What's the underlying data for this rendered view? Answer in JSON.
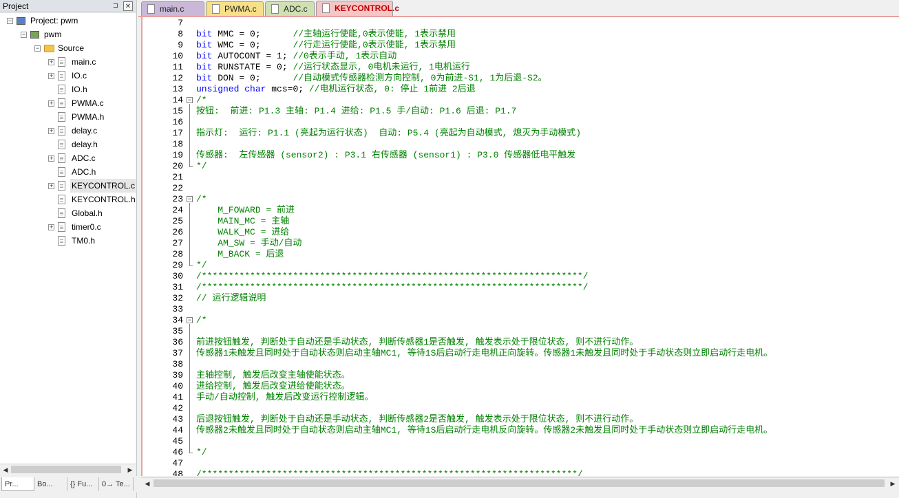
{
  "project_panel": {
    "title": "Project",
    "pin_glyph": "⊐",
    "close_glyph": "✕",
    "tree": [
      {
        "label": "Project: pwm",
        "type": "project",
        "expanded": true
      },
      {
        "label": "pwm",
        "type": "target",
        "expanded": true
      },
      {
        "label": "Source",
        "type": "folder",
        "expanded": true
      },
      {
        "label": "main.c",
        "type": "file",
        "expandable": true
      },
      {
        "label": "IO.c",
        "type": "file",
        "expandable": true
      },
      {
        "label": "IO.h",
        "type": "file",
        "expandable": false
      },
      {
        "label": "PWMA.c",
        "type": "file",
        "expandable": true
      },
      {
        "label": "PWMA.h",
        "type": "file",
        "expandable": false
      },
      {
        "label": "delay.c",
        "type": "file",
        "expandable": true
      },
      {
        "label": "delay.h",
        "type": "file",
        "expandable": false
      },
      {
        "label": "ADC.c",
        "type": "file",
        "expandable": true
      },
      {
        "label": "ADC.h",
        "type": "file",
        "expandable": false
      },
      {
        "label": "KEYCONTROL.c",
        "type": "file",
        "expandable": true,
        "selected": true
      },
      {
        "label": "KEYCONTROL.h",
        "type": "file",
        "expandable": false
      },
      {
        "label": "Global.h",
        "type": "file",
        "expandable": false
      },
      {
        "label": "timer0.c",
        "type": "file",
        "expandable": true
      },
      {
        "label": "TM0.h",
        "type": "file",
        "expandable": false
      }
    ],
    "bottom_tabs": [
      {
        "label": "Pr...",
        "icon": "project-window-icon",
        "active": true
      },
      {
        "label": "Bo...",
        "icon": "books-icon",
        "active": false
      },
      {
        "label": "{} Fu...",
        "icon": "functions-icon",
        "active": false
      },
      {
        "label": "0→ Te...",
        "icon": "templates-icon",
        "active": false
      }
    ]
  },
  "editor": {
    "tabs": [
      {
        "label": "main.c",
        "color": "#c9b8d8",
        "active": false
      },
      {
        "label": "PWMA.c",
        "color": "#f6e089",
        "active": false
      },
      {
        "label": "ADC.c",
        "color": "#cfe0b2",
        "active": false
      },
      {
        "label": "KEYCONTROL.c",
        "color": "#f5c6c6",
        "active": true
      }
    ],
    "lines": [
      {
        "n": "7",
        "parts": []
      },
      {
        "n": "8",
        "parts": [
          {
            "t": "bit",
            "c": "kw"
          },
          {
            "t": " MMC = 0;      ",
            "c": ""
          },
          {
            "t": "//主轴运行使能,0表示使能, 1表示禁用",
            "c": "cm"
          }
        ]
      },
      {
        "n": "9",
        "parts": [
          {
            "t": "bit",
            "c": "kw"
          },
          {
            "t": " WMC = 0;      ",
            "c": ""
          },
          {
            "t": "//行走运行使能,0表示使能, 1表示禁用",
            "c": "cm"
          }
        ]
      },
      {
        "n": "10",
        "parts": [
          {
            "t": "bit",
            "c": "kw"
          },
          {
            "t": " AUTOCONT = 1; ",
            "c": ""
          },
          {
            "t": "//0表示手动, 1表示自动",
            "c": "cm"
          }
        ]
      },
      {
        "n": "11",
        "parts": [
          {
            "t": "bit",
            "c": "kw"
          },
          {
            "t": " RUNSTATE = 0; ",
            "c": ""
          },
          {
            "t": "//运行状态显示, 0电机未运行, 1电机运行",
            "c": "cm"
          }
        ]
      },
      {
        "n": "12",
        "parts": [
          {
            "t": "bit",
            "c": "kw"
          },
          {
            "t": " DON = 0;      ",
            "c": ""
          },
          {
            "t": "//自动模式传感器检测方向控制, 0为前进-S1, 1为后退-S2。",
            "c": "cm"
          }
        ]
      },
      {
        "n": "13",
        "parts": [
          {
            "t": "unsigned",
            "c": "kw"
          },
          {
            "t": " ",
            "c": ""
          },
          {
            "t": "char",
            "c": "kw"
          },
          {
            "t": " mcs=0; ",
            "c": ""
          },
          {
            "t": "//电机运行状态, 0: 停止 1前进 2后退",
            "c": "cm"
          }
        ]
      },
      {
        "n": "14",
        "parts": [
          {
            "t": "/*",
            "c": "cm"
          }
        ]
      },
      {
        "n": "15",
        "parts": [
          {
            "t": "按钮:  前进: P1.3 主轴: P1.4 进给: P1.5 手/自动: P1.6 后退: P1.7",
            "c": "cm"
          }
        ]
      },
      {
        "n": "16",
        "parts": []
      },
      {
        "n": "17",
        "parts": [
          {
            "t": "指示灯:  运行: P1.1 (亮起为运行状态)  自动: P5.4 (亮起为自动模式, 熄灭为手动模式)",
            "c": "cm"
          }
        ]
      },
      {
        "n": "18",
        "parts": []
      },
      {
        "n": "19",
        "parts": [
          {
            "t": "传感器:  左传感器 (sensor2) : P3.1 右传感器 (sensor1) : P3.0 传感器低电平触发",
            "c": "cm"
          }
        ]
      },
      {
        "n": "20",
        "parts": [
          {
            "t": "*/",
            "c": "cm"
          }
        ]
      },
      {
        "n": "21",
        "parts": []
      },
      {
        "n": "22",
        "parts": []
      },
      {
        "n": "23",
        "parts": [
          {
            "t": "/*",
            "c": "cm"
          }
        ]
      },
      {
        "n": "24",
        "parts": [
          {
            "t": "    M_FOWARD = 前进",
            "c": "cm"
          }
        ]
      },
      {
        "n": "25",
        "parts": [
          {
            "t": "    MAIN_MC = 主轴",
            "c": "cm"
          }
        ]
      },
      {
        "n": "26",
        "parts": [
          {
            "t": "    WALK_MC = 进给",
            "c": "cm"
          }
        ]
      },
      {
        "n": "27",
        "parts": [
          {
            "t": "    AM_SW = 手动/自动",
            "c": "cm"
          }
        ]
      },
      {
        "n": "28",
        "parts": [
          {
            "t": "    M_BACK = 后退",
            "c": "cm"
          }
        ]
      },
      {
        "n": "29",
        "parts": [
          {
            "t": "*/",
            "c": "cm"
          }
        ]
      },
      {
        "n": "30",
        "parts": [
          {
            "t": "/***********************************************************************/",
            "c": "cm"
          }
        ]
      },
      {
        "n": "31",
        "parts": [
          {
            "t": "/***********************************************************************/",
            "c": "cm"
          }
        ]
      },
      {
        "n": "32",
        "parts": [
          {
            "t": "// 运行逻辑说明",
            "c": "cm"
          }
        ]
      },
      {
        "n": "33",
        "parts": []
      },
      {
        "n": "34",
        "parts": [
          {
            "t": "/*",
            "c": "cm"
          }
        ]
      },
      {
        "n": "35",
        "parts": []
      },
      {
        "n": "36",
        "parts": [
          {
            "t": "前进按钮触发, 判断处于自动还是手动状态, 判断传感器1是否触发, 触发表示处于限位状态, 则不进行动作。",
            "c": "cm"
          }
        ]
      },
      {
        "n": "37",
        "parts": [
          {
            "t": "传感器1未触发且同时处于自动状态则启动主轴MC1, 等待1S后启动行走电机正向旋转。传感器1未触发且同时处于手动状态则立即启动行走电机。",
            "c": "cm"
          }
        ]
      },
      {
        "n": "38",
        "parts": []
      },
      {
        "n": "39",
        "parts": [
          {
            "t": "主轴控制, 触发后改变主轴使能状态。",
            "c": "cm"
          }
        ]
      },
      {
        "n": "40",
        "parts": [
          {
            "t": "进给控制, 触发后改变进给使能状态。",
            "c": "cm"
          }
        ]
      },
      {
        "n": "41",
        "parts": [
          {
            "t": "手动/自动控制, 触发后改变运行控制逻辑。",
            "c": "cm"
          }
        ]
      },
      {
        "n": "42",
        "parts": []
      },
      {
        "n": "43",
        "parts": [
          {
            "t": "后退按钮触发, 判断处于自动还是手动状态, 判断传感器2是否触发, 触发表示处于限位状态, 则不进行动作。",
            "c": "cm"
          }
        ]
      },
      {
        "n": "44",
        "parts": [
          {
            "t": "传感器2未触发且同时处于自动状态则启动主轴MC1, 等待1S后启动行走电机反向旋转。传感器2未触发且同时处于手动状态则立即启动行走电机。",
            "c": "cm"
          }
        ]
      },
      {
        "n": "45",
        "parts": []
      },
      {
        "n": "46",
        "parts": [
          {
            "t": "*/",
            "c": "cm"
          }
        ]
      },
      {
        "n": "47",
        "parts": []
      },
      {
        "n": "48",
        "parts": [
          {
            "t": "/**********************************************************************/",
            "c": "cm"
          }
        ]
      }
    ],
    "folds": [
      {
        "start": "14",
        "end": "20"
      },
      {
        "start": "23",
        "end": "29"
      },
      {
        "start": "34",
        "end": "46"
      }
    ]
  }
}
